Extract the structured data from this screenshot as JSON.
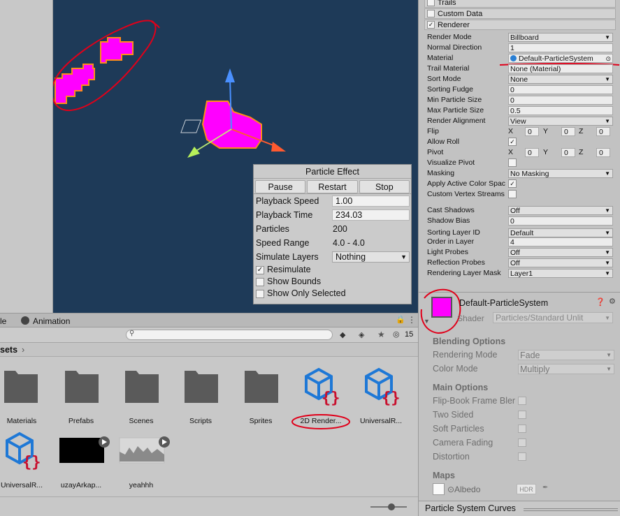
{
  "project": {
    "tabs": [
      {
        "label": "le"
      },
      {
        "label": "Animation"
      }
    ],
    "search": {
      "value": "",
      "placeholder": ""
    },
    "hidden_count": "15",
    "breadcrumb": [
      "sets"
    ],
    "assets": [
      {
        "label": "Materials",
        "icon": "folder-icon"
      },
      {
        "label": "Prefabs",
        "icon": "folder-icon"
      },
      {
        "label": "Scenes",
        "icon": "folder-icon"
      },
      {
        "label": "Scripts",
        "icon": "folder-icon"
      },
      {
        "label": "Sprites",
        "icon": "folder-icon"
      },
      {
        "label": "2D Render...",
        "icon": "script-asset-icon"
      },
      {
        "label": "UniversalR...",
        "icon": "script-asset-icon"
      },
      {
        "label": "UniversalR...",
        "icon": "script-asset-icon"
      },
      {
        "label": "uzayArkap...",
        "icon": "audio-clip-icon"
      },
      {
        "label": "yeahhh",
        "icon": "audio-clip-icon"
      }
    ]
  },
  "particle_effect": {
    "title": "Particle Effect",
    "buttons": [
      "Pause",
      "Restart",
      "Stop"
    ],
    "playback_speed_label": "Playback Speed",
    "playback_speed": "1.00",
    "playback_time_label": "Playback Time",
    "playback_time": "234.03",
    "particles_label": "Particles",
    "particles": "200",
    "speed_range_label": "Speed Range",
    "speed_range": "4.0 - 4.0",
    "simulate_layers_label": "Simulate Layers",
    "simulate_layers": "Nothing",
    "resimulate_label": "Resimulate",
    "resimulate": true,
    "show_bounds_label": "Show Bounds",
    "show_only_selected_label": "Show Only Selected"
  },
  "inspector": {
    "sections": [
      {
        "label": "Trails",
        "checked": false
      },
      {
        "label": "Custom Data",
        "checked": false
      },
      {
        "label": "Renderer",
        "checked": true
      }
    ],
    "renderer": {
      "render_mode": {
        "label": "Render Mode",
        "value": "Billboard"
      },
      "normal_direction": {
        "label": "Normal Direction",
        "value": "1"
      },
      "material": {
        "label": "Material",
        "value": "Default-ParticleSystem"
      },
      "trail_material": {
        "label": "Trail Material",
        "value": "None (Material)"
      },
      "sort_mode": {
        "label": "Sort Mode",
        "value": "None"
      },
      "sorting_fudge": {
        "label": "Sorting Fudge",
        "value": "0"
      },
      "min_particle_size": {
        "label": "Min Particle Size",
        "value": "0"
      },
      "max_particle_size": {
        "label": "Max Particle Size",
        "value": "0.5"
      },
      "render_alignment": {
        "label": "Render Alignment",
        "value": "View"
      },
      "flip": {
        "label": "Flip",
        "x": "0",
        "y": "0",
        "z": "0"
      },
      "allow_roll": {
        "label": "Allow Roll",
        "checked": true
      },
      "pivot": {
        "label": "Pivot",
        "x": "0",
        "y": "0",
        "z": "0"
      },
      "visualize_pivot": {
        "label": "Visualize Pivot",
        "checked": false
      },
      "masking": {
        "label": "Masking",
        "value": "No Masking"
      },
      "apply_active_color_space": {
        "label": "Apply Active Color Spac",
        "checked": true
      },
      "custom_vertex_streams": {
        "label": "Custom Vertex Streams",
        "checked": false
      },
      "cast_shadows": {
        "label": "Cast Shadows",
        "value": "Off"
      },
      "shadow_bias": {
        "label": "Shadow Bias",
        "value": "0"
      },
      "sorting_layer_id": {
        "label": "Sorting Layer ID",
        "value": "Default"
      },
      "order_in_layer": {
        "label": "Order in Layer",
        "value": "4"
      },
      "light_probes": {
        "label": "Light Probes",
        "value": "Off"
      },
      "reflection_probes": {
        "label": "Reflection Probes",
        "value": "Off"
      },
      "rendering_layer_mask": {
        "label": "Rendering Layer Mask",
        "value": "Layer1"
      }
    },
    "axis_labels": {
      "x": "X",
      "y": "Y",
      "z": "Z"
    },
    "material_panel": {
      "name": "Default-ParticleSystem",
      "shader_label": "Shader",
      "shader": "Particles/Standard Unlit",
      "swatch_color": "#ff00ff",
      "blending_title": "Blending Options",
      "rendering_mode": {
        "label": "Rendering Mode",
        "value": "Fade"
      },
      "color_mode": {
        "label": "Color Mode",
        "value": "Multiply"
      },
      "main_title": "Main Options",
      "flipbook_label": "Flip-Book Frame Bler",
      "two_sided_label": "Two Sided",
      "soft_particles_label": "Soft Particles",
      "camera_fading_label": "Camera Fading",
      "distortion_label": "Distortion",
      "maps_title": "Maps",
      "albedo_label": "Albedo",
      "hdr_label": "HDR"
    },
    "curves_title": "Particle System Curves"
  },
  "colors": {
    "scene_bg": "#1e3a58",
    "particle": "#ff00ff",
    "annotation": "#e0001a"
  }
}
